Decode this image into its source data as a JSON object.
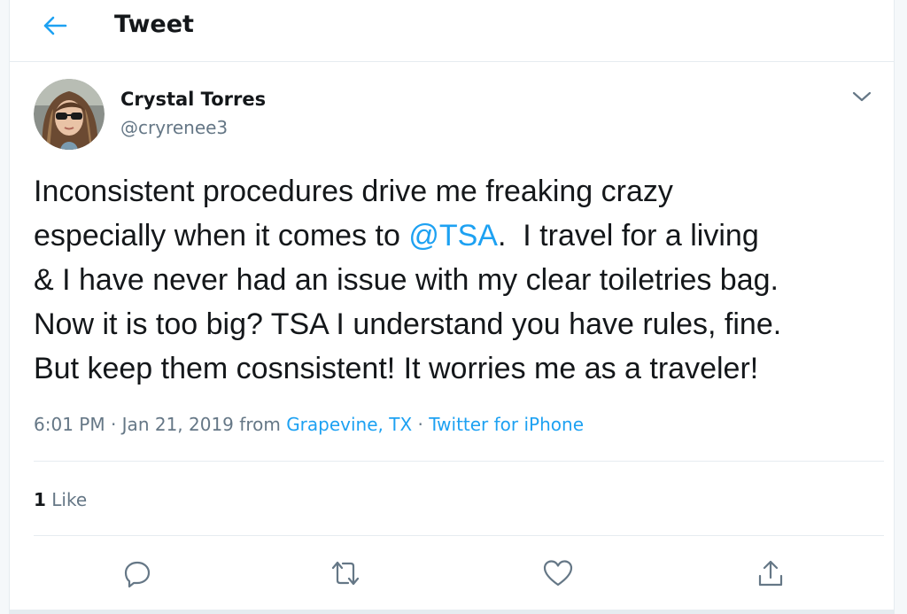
{
  "header": {
    "title": "Tweet",
    "back_icon": "arrow-left-icon"
  },
  "author": {
    "display_name": "Crystal Torres",
    "handle": "@cryrenee3",
    "avatar": "user-avatar-photo"
  },
  "tweet": {
    "text_before_mention": "Inconsistent procedures drive me freaking crazy\nespecially when it comes to ",
    "mention": "@TSA",
    "text_after_mention": ".  I travel for a living\n& I have never had an issue with my clear toiletries bag.\nNow it is too big? TSA I understand you have rules, fine.\nBut keep them cosnsistent! It worries me as a traveler!"
  },
  "meta": {
    "time_date": "6:01 PM · Jan 21, 2019",
    "from_label": " from ",
    "location": "Grapevine, TX",
    "separator": " · ",
    "source": "Twitter for iPhone"
  },
  "stats": {
    "like_count": "1",
    "like_label": " Like"
  },
  "actions": [
    {
      "icon": "reply-icon"
    },
    {
      "icon": "retweet-icon"
    },
    {
      "icon": "heart-icon"
    },
    {
      "icon": "share-icon"
    }
  ],
  "colors": {
    "accent": "#1da1f2",
    "text": "#14171a",
    "secondary": "#657786",
    "border": "#e6ecf0"
  }
}
